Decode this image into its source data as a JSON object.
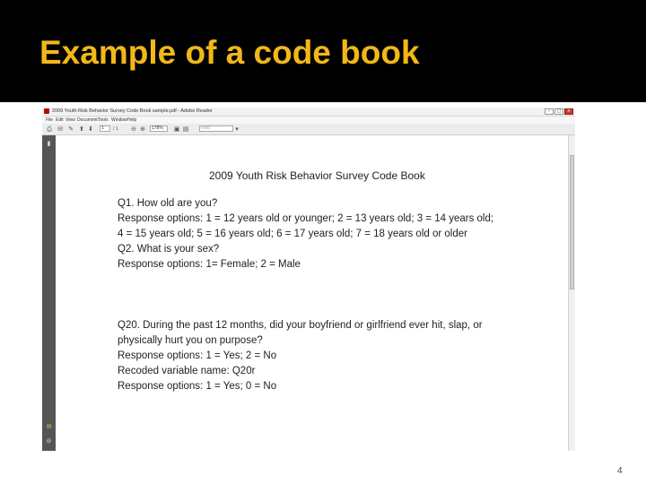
{
  "slide": {
    "title": "Example of a code book",
    "page_number": "4"
  },
  "reader": {
    "window_title": "2009 Youth Risk Behavior Survey Code Book sample.pdf - Adobe Reader",
    "menu": [
      "File",
      "Edit",
      "View",
      "Document",
      "Tools",
      "Window",
      "Help"
    ],
    "page_current": "1",
    "page_total": "/ 1",
    "zoom": "178%",
    "find_placeholder": "Find"
  },
  "document": {
    "heading": "2009 Youth Risk Behavior Survey Code Book",
    "lines": [
      "Q1. How old are you?",
      "Response options: 1 = 12 years old or younger; 2 = 13 years old; 3 = 14 years old;",
      "4 = 15 years old; 5 = 16 years old; 6 = 17 years old; 7 = 18 years old or older",
      "Q2. What is your sex?",
      "Response options: 1= Female; 2 = Male",
      "Q20. During the past 12 months, did your boyfriend or girlfriend ever hit, slap, or",
      "physically hurt you on purpose?",
      "Response options: 1 = Yes; 2 = No",
      "Recoded variable name: Q20r",
      "Response options: 1 = Yes; 0 = No"
    ]
  },
  "colors": {
    "title": "#f2b718",
    "header_bg": "#000000",
    "nav_pane": "#555555"
  }
}
